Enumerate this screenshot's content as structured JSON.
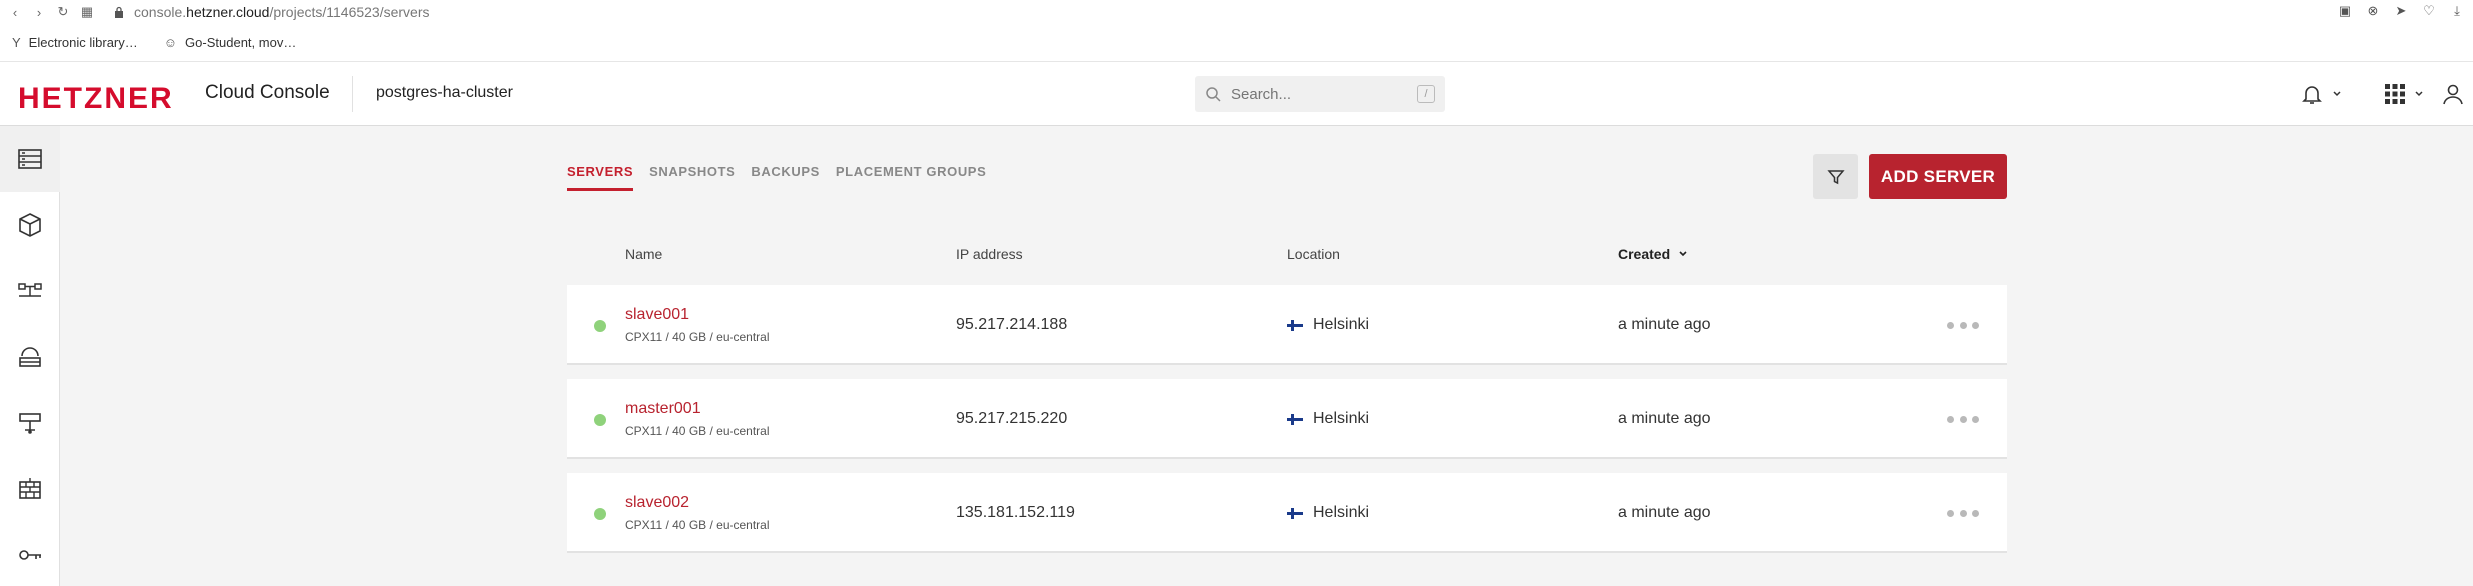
{
  "browser": {
    "url_prefix": "console.",
    "url_host": "hetzner.cloud",
    "url_path": "/projects/1146523/servers",
    "bookmarks": [
      {
        "icon": "Y",
        "label": "Electronic library…"
      },
      {
        "icon": "☺",
        "label": "Go-Student, mov…"
      }
    ]
  },
  "header": {
    "logo": "HETZNER",
    "product": "Cloud Console",
    "project": "postgres-ha-cluster",
    "search_placeholder": "Search...",
    "search_shortcut": "/"
  },
  "tabs": [
    {
      "label": "SERVERS",
      "active": true
    },
    {
      "label": "SNAPSHOTS",
      "active": false
    },
    {
      "label": "BACKUPS",
      "active": false
    },
    {
      "label": "PLACEMENT GROUPS",
      "active": false
    }
  ],
  "actions": {
    "add_server": "ADD SERVER"
  },
  "table": {
    "columns": {
      "name": "Name",
      "ip": "IP address",
      "location": "Location",
      "created": "Created"
    },
    "rows": [
      {
        "name": "slave001",
        "spec": "CPX11 / 40 GB / eu-central",
        "ip": "95.217.214.188",
        "location": "Helsinki",
        "created": "a minute ago",
        "status": "running"
      },
      {
        "name": "master001",
        "spec": "CPX11 / 40 GB / eu-central",
        "ip": "95.217.215.220",
        "location": "Helsinki",
        "created": "a minute ago",
        "status": "running"
      },
      {
        "name": "slave002",
        "spec": "CPX11 / 40 GB / eu-central",
        "ip": "135.181.152.119",
        "location": "Helsinki",
        "created": "a minute ago",
        "status": "running"
      }
    ]
  },
  "colors": {
    "brand": "#d50c2d",
    "accent": "#b8232f",
    "status_running": "#8fd27b"
  }
}
